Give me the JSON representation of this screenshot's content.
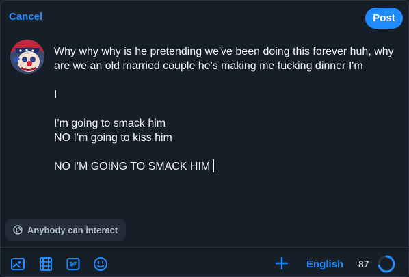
{
  "header": {
    "cancel_label": "Cancel",
    "post_label": "Post"
  },
  "composer": {
    "avatar": "user-avatar",
    "text": "Why why why is he pretending we've been doing this forever huh, why are we an old married couple he's making me fucking dinner I'm\n\nI\n\nI'm going to smack him\nNO I'm going to kiss him\n\nNO I'M GOING TO SMACK HIM"
  },
  "interaction_setting": {
    "icon": "globe-icon",
    "label": "Anybody can interact"
  },
  "toolbar": {
    "tools": [
      "image-icon",
      "video-icon",
      "gif-icon",
      "emoji-icon"
    ],
    "thread_add_icon": "plus-icon",
    "language_label": "English",
    "remaining_count": "87",
    "character_progress": 0.71
  },
  "colors": {
    "background": "#161e27",
    "accent": "#208bfe",
    "chip_background": "#222c38",
    "muted_text": "#aebbc9"
  }
}
